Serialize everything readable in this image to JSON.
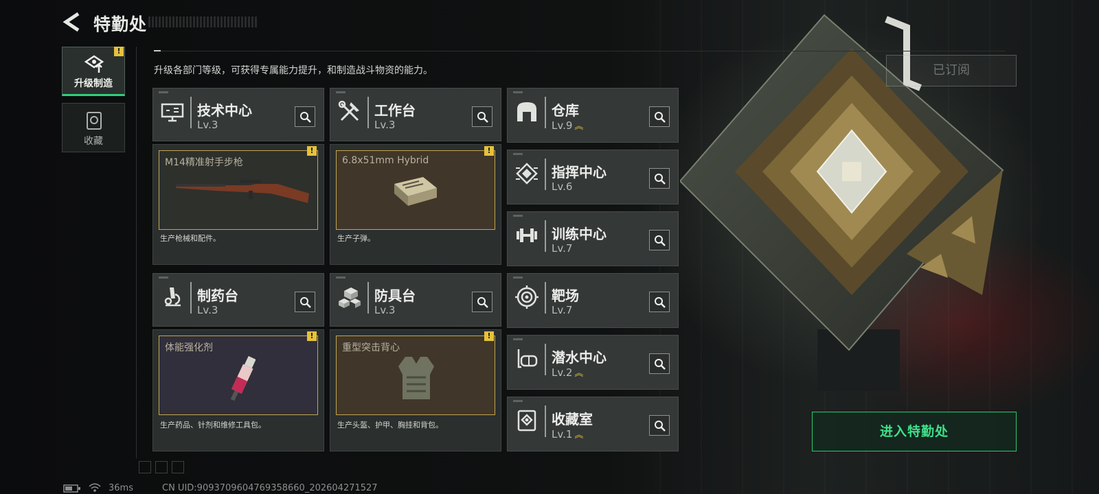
{
  "header": {
    "title": "特勤处"
  },
  "side_nav": [
    {
      "label": "升级制造",
      "active": true,
      "warning": "!"
    },
    {
      "label": "收藏",
      "active": false
    }
  ],
  "subtitle": "升级各部门等级，可获得专属能力提升，和制造战斗物资的能力。",
  "facilities": {
    "tech_center": {
      "name": "技术中心",
      "level": "Lv.3",
      "icon": "monitor-icon"
    },
    "workbench": {
      "name": "工作台",
      "level": "Lv.3",
      "icon": "tools-icon"
    },
    "pharmacy": {
      "name": "制药台",
      "level": "Lv.3",
      "icon": "microscope-icon"
    },
    "armor_bench": {
      "name": "防具台",
      "level": "Lv.3",
      "icon": "cubes-icon"
    },
    "warehouse": {
      "name": "仓库",
      "level": "Lv.9",
      "upgradable": true,
      "icon": "warehouse-icon"
    },
    "command_center": {
      "name": "指挥中心",
      "level": "Lv.6",
      "icon": "chip-icon"
    },
    "training_center": {
      "name": "训练中心",
      "level": "Lv.7",
      "icon": "dumbbell-icon"
    },
    "shooting_range": {
      "name": "靶场",
      "level": "Lv.7",
      "icon": "target-icon"
    },
    "diving_center": {
      "name": "潜水中心",
      "level": "Lv.2",
      "upgradable": true,
      "icon": "diving-mask-icon"
    },
    "collection_room": {
      "name": "收藏室",
      "level": "Lv.1",
      "upgradable": true,
      "icon": "collection-icon"
    }
  },
  "products": {
    "tech_center": {
      "item": "M14精准射手步枪",
      "desc": "生产枪械和配件。",
      "warning": "!",
      "icon": "rifle-icon"
    },
    "workbench": {
      "item": "6.8x51mm Hybrid",
      "desc": "生产子弹。",
      "warning": "!",
      "icon": "ammo-box-icon"
    },
    "pharmacy": {
      "item": "体能强化剂",
      "desc": "生产药品、针剂和维修工具包。",
      "warning": "!",
      "icon": "syringe-icon"
    },
    "armor_bench": {
      "item": "重型突击背心",
      "desc": "生产头盔、护甲、胸挂和背包。",
      "warning": "!",
      "icon": "vest-icon"
    }
  },
  "buttons": {
    "enter": "进入特勤处",
    "subscribed": "已订阅"
  },
  "status_bar": {
    "ping": "36ms",
    "uid": "CN UID:9093709604769358660_202604271527"
  },
  "colors": {
    "accent_green": "#2cc872",
    "warning_yellow": "#e6c23a",
    "product_frame": "#c2a650",
    "card_bg": "#343837"
  }
}
